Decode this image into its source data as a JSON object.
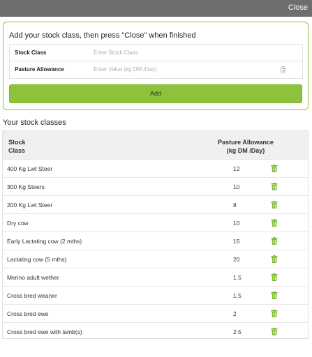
{
  "topbar": {
    "close_label": "Close"
  },
  "add_panel": {
    "heading": "Add your stock class, then press \"Close\" when finished",
    "stock_class": {
      "label": "Stock Class",
      "placeholder": "Enter Stock Class",
      "value": ""
    },
    "pasture_allowance": {
      "label": "Pasture Allowance",
      "placeholder": "Enter Value (kg DM /Day)",
      "value": ""
    },
    "add_label": "Add"
  },
  "stock_classes": {
    "title": "Your stock classes",
    "headers": {
      "stock_line1": "Stock",
      "stock_line2": "Class",
      "pa_line1": "Pasture Allowance",
      "pa_line2": "(kg DM /Day)"
    },
    "rows": [
      {
        "name": "400 Kg Lwt Steer",
        "value": "12"
      },
      {
        "name": "300 Kg Steers",
        "value": "10"
      },
      {
        "name": "200 Kg Lwt Steer",
        "value": "8"
      },
      {
        "name": "Dry cow",
        "value": "10"
      },
      {
        "name": "Early Lactating cow (2 mths)",
        "value": "15"
      },
      {
        "name": "Lactating cow (5 mths)",
        "value": "20"
      },
      {
        "name": "Merino adult wether",
        "value": "1.5"
      },
      {
        "name": "Cross bred weaner",
        "value": "1.5"
      },
      {
        "name": "Cross bred ewe",
        "value": "2"
      },
      {
        "name": "Cross bred ewe with lamb(s)",
        "value": "2.5"
      }
    ]
  },
  "colors": {
    "accent": "#8cc33b",
    "topbar": "#6e6e6e",
    "trash_icon": "#7cb82f"
  },
  "icons": {
    "delete": "trash-icon"
  }
}
